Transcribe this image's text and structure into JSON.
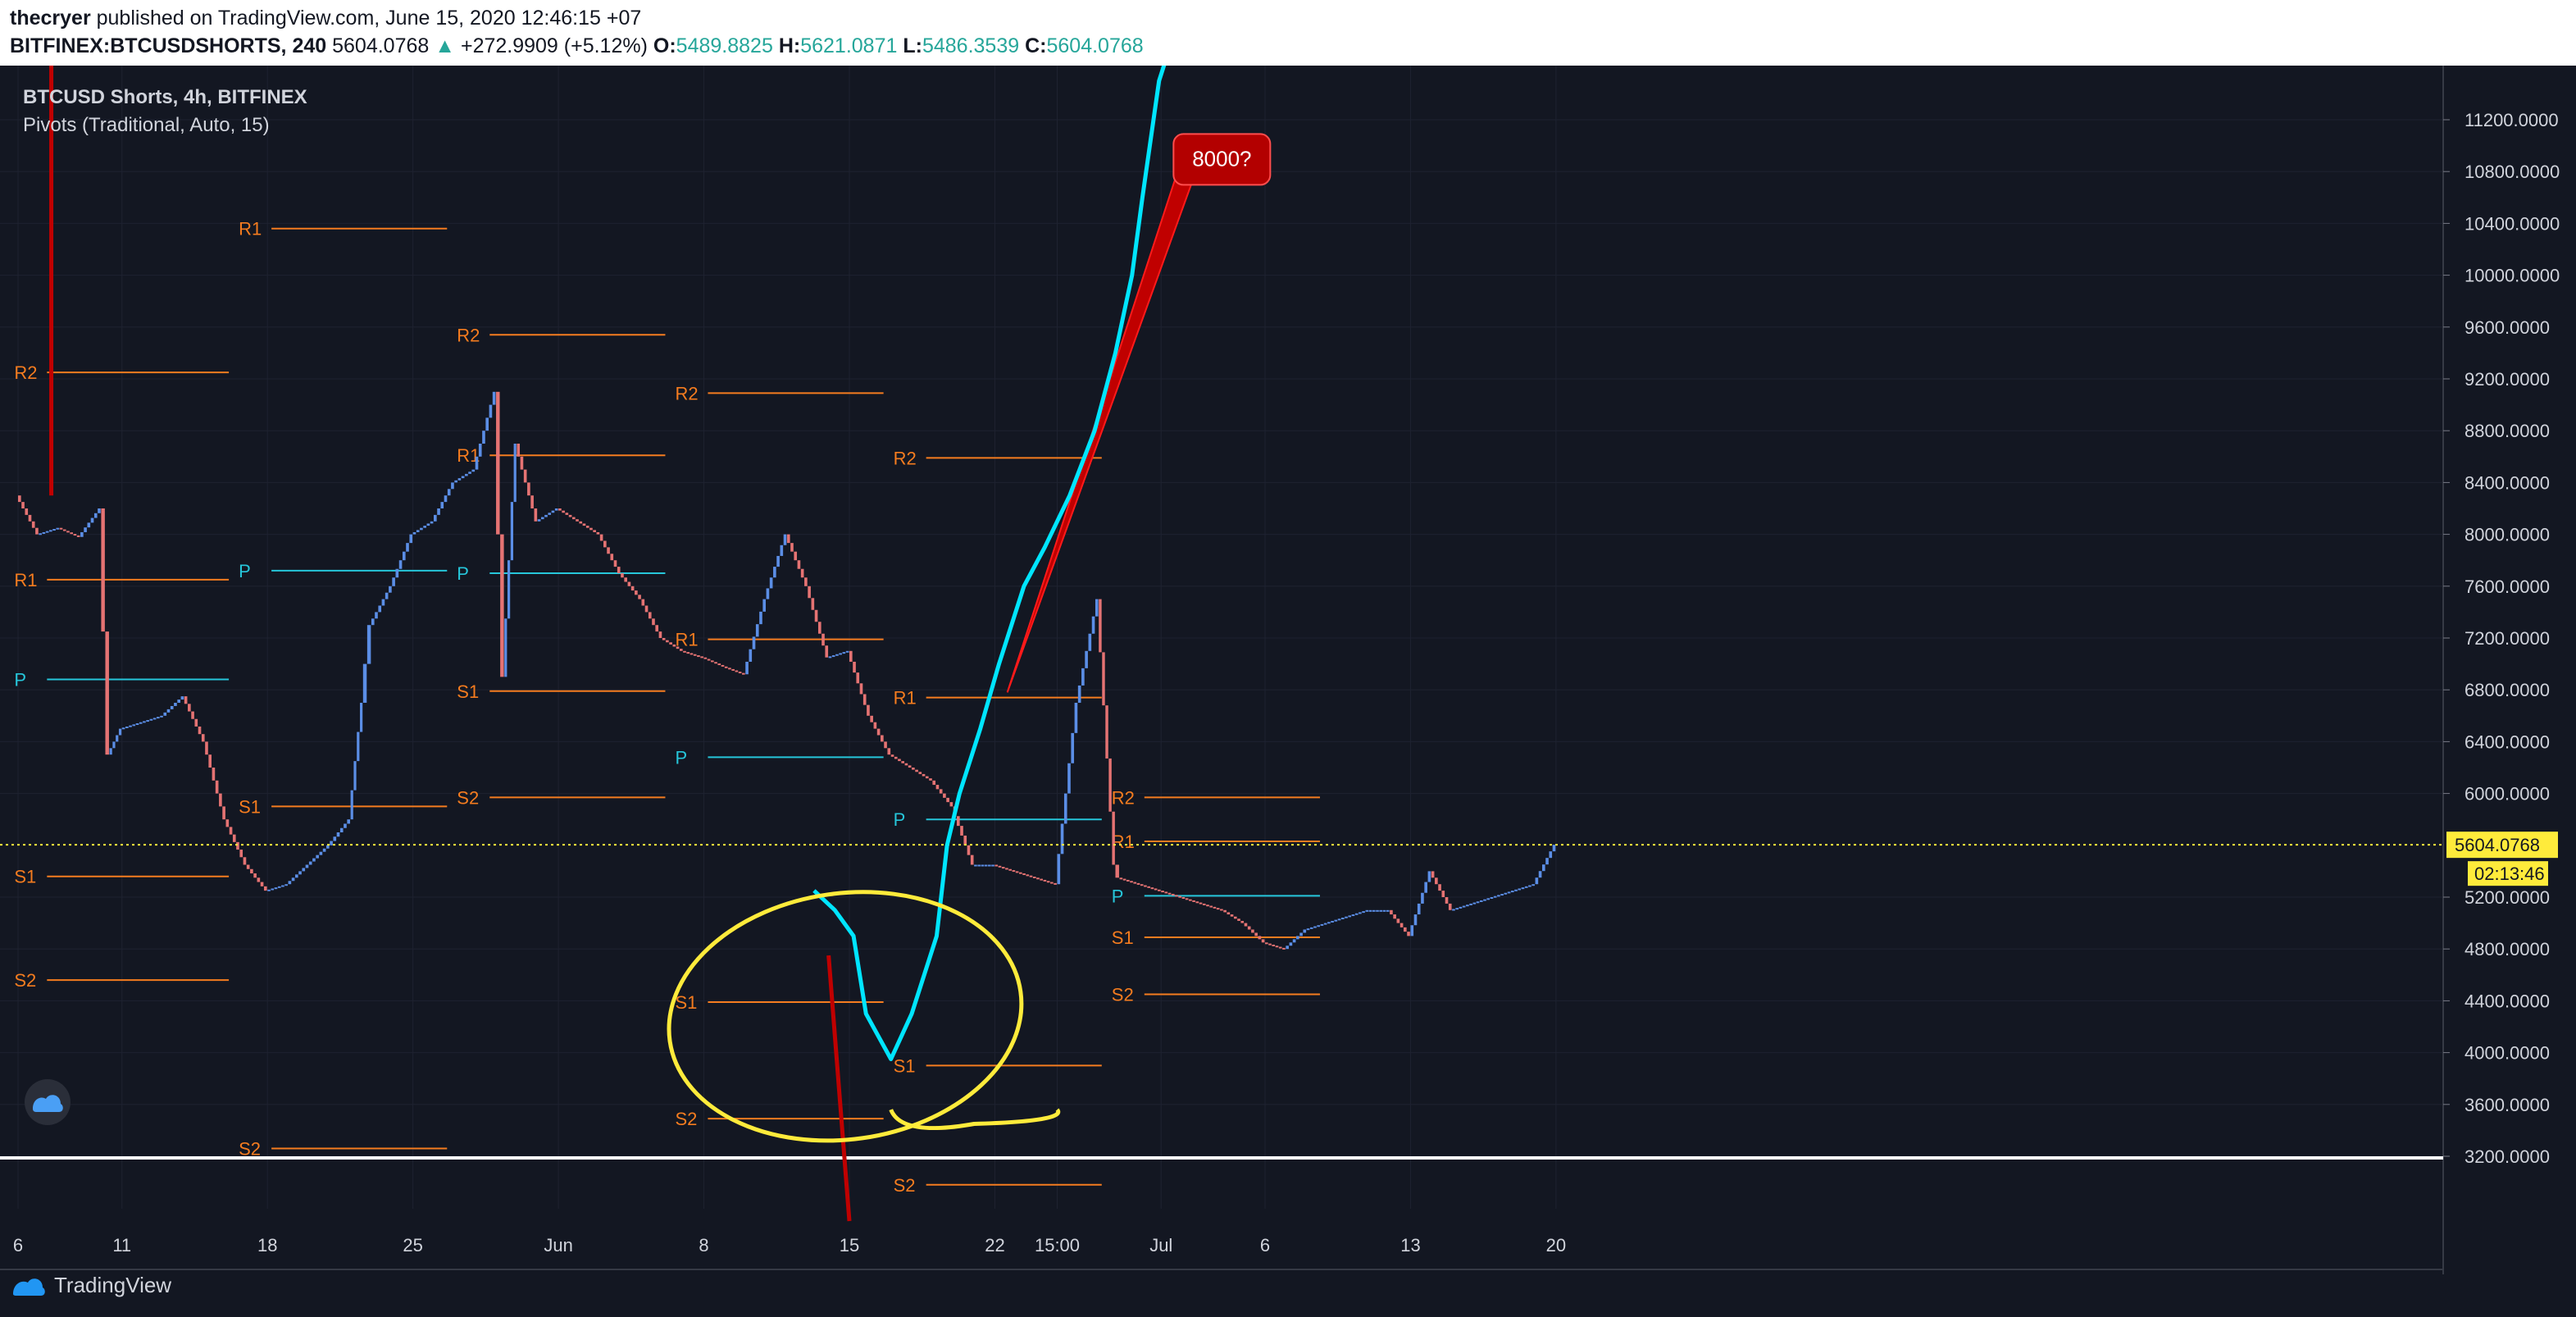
{
  "header": {
    "author": "thecryer",
    "published": "published on TradingView.com, June 15, 2020 12:46:15 +07",
    "symbol": "BITFINEX:BTCUSDSHORTS, 240",
    "last": "5604.0768",
    "change": "+272.9909 (+5.12%)",
    "o_label": "O:",
    "o": "5489.8825",
    "h_label": "H:",
    "h": "5621.0871",
    "l_label": "L:",
    "l": "5486.3539",
    "c_label": "C:",
    "c": "5604.0768"
  },
  "legend": {
    "title": "BTCUSD Shorts, 4h, BITFINEX",
    "indicator": "Pivots (Traditional, Auto, 15)"
  },
  "footer": {
    "brand": "TradingView"
  },
  "colors": {
    "background": "#131722",
    "grid": "#1e2230",
    "up": "#5b8ee6",
    "down": "#e57373",
    "pivot_orange": "#f57c1f",
    "pivot_cyan": "#26c6da",
    "price_line": "#ffeb3b",
    "annotation_red": "#c00000",
    "annotation_cyan": "#00e5ff",
    "annotation_yellow": "#ffeb3b"
  },
  "chart_data": {
    "type": "candlestick",
    "y_axis_labels": [
      "11200.0000",
      "10800.0000",
      "10400.0000",
      "10000.0000",
      "9600.0000",
      "9200.0000",
      "8800.0000",
      "8400.0000",
      "8000.0000",
      "7600.0000",
      "7200.0000",
      "6800.0000",
      "6400.0000",
      "6000.0000",
      "5200.0000",
      "4800.0000",
      "4400.0000",
      "4000.0000",
      "3600.0000",
      "3200.0000"
    ],
    "y_axis_values": [
      11200,
      10800,
      10400,
      10000,
      9600,
      9200,
      8800,
      8400,
      8000,
      7600,
      7200,
      6800,
      6400,
      6000,
      5200,
      4800,
      4400,
      4000,
      3600,
      3200
    ],
    "x_axis_labels": [
      "6",
      "11",
      "18",
      "25",
      "Jun",
      "8",
      "15",
      "22",
      "15:00",
      "Jul",
      "6",
      "13",
      "20"
    ],
    "x_axis_day_index": [
      0,
      5,
      12,
      19,
      26,
      33,
      40,
      47,
      50,
      55,
      60,
      67,
      74
    ],
    "ylim": [
      2760,
      11870
    ],
    "last_price": {
      "value": 5604.0768,
      "label": "5604.0768",
      "countdown": "02:13:46"
    },
    "close_path": [
      [
        0,
        8300
      ],
      [
        1,
        8000
      ],
      [
        2,
        8050
      ],
      [
        3,
        7980
      ],
      [
        4,
        8200
      ],
      [
        4.4,
        6300
      ],
      [
        5,
        6500
      ],
      [
        6,
        6550
      ],
      [
        7,
        6600
      ],
      [
        8,
        6750
      ],
      [
        9,
        6400
      ],
      [
        10,
        5800
      ],
      [
        11,
        5450
      ],
      [
        12,
        5250
      ],
      [
        13,
        5300
      ],
      [
        14,
        5450
      ],
      [
        15,
        5600
      ],
      [
        16,
        5800
      ],
      [
        16.6,
        6700
      ],
      [
        17,
        7300
      ],
      [
        18,
        7600
      ],
      [
        19,
        8000
      ],
      [
        20,
        8100
      ],
      [
        21,
        8400
      ],
      [
        22,
        8500
      ],
      [
        23,
        9100
      ],
      [
        23.4,
        6900
      ],
      [
        24,
        8700
      ],
      [
        25,
        8100
      ],
      [
        26,
        8200
      ],
      [
        27,
        8100
      ],
      [
        28,
        8000
      ],
      [
        29,
        7700
      ],
      [
        30,
        7500
      ],
      [
        31,
        7200
      ],
      [
        32,
        7100
      ],
      [
        33,
        7050
      ],
      [
        34,
        6980
      ],
      [
        35,
        6920
      ],
      [
        36,
        7500
      ],
      [
        37,
        8000
      ],
      [
        38,
        7600
      ],
      [
        39,
        7050
      ],
      [
        40,
        7100
      ],
      [
        41,
        6600
      ],
      [
        42,
        6300
      ],
      [
        43,
        6200
      ],
      [
        44,
        6100
      ],
      [
        45,
        5900
      ],
      [
        46,
        5450
      ],
      [
        47,
        5450
      ],
      [
        48,
        5400
      ],
      [
        49,
        5350
      ],
      [
        50,
        5300
      ],
      [
        51,
        6700
      ],
      [
        52,
        7500
      ],
      [
        52.8,
        5450
      ],
      [
        53,
        5350
      ],
      [
        54,
        5300
      ],
      [
        55,
        5250
      ],
      [
        56,
        5200
      ],
      [
        57,
        5150
      ],
      [
        58,
        5100
      ],
      [
        59,
        5000
      ],
      [
        60,
        4850
      ],
      [
        61,
        4800
      ],
      [
        62,
        4950
      ],
      [
        63,
        5000
      ],
      [
        64,
        5050
      ],
      [
        65,
        5100
      ],
      [
        66,
        5100
      ],
      [
        67,
        4900
      ],
      [
        68,
        5400
      ],
      [
        69,
        5100
      ],
      [
        70,
        5150
      ],
      [
        71,
        5200
      ],
      [
        72,
        5250
      ],
      [
        73,
        5300
      ],
      [
        74,
        5604
      ]
    ],
    "pivots": [
      {
        "period_start": -0.5,
        "period_end": 10.3,
        "levels": [
          {
            "name": "R2",
            "value": 9250
          },
          {
            "name": "R1",
            "value": 7650
          },
          {
            "name": "P",
            "value": 6880
          },
          {
            "name": "S1",
            "value": 5360
          },
          {
            "name": "S2",
            "value": 4560
          }
        ]
      },
      {
        "period_start": 10.3,
        "period_end": 20.8,
        "levels": [
          {
            "name": "R1",
            "value": 10360
          },
          {
            "name": "P",
            "value": 7720
          },
          {
            "name": "S1",
            "value": 5900
          },
          {
            "name": "S2",
            "value": 3260
          }
        ]
      },
      {
        "period_start": 20.8,
        "period_end": 31.3,
        "levels": [
          {
            "name": "R2",
            "value": 9540
          },
          {
            "name": "R1",
            "value": 8610
          },
          {
            "name": "P",
            "value": 7700
          },
          {
            "name": "S1",
            "value": 6790
          },
          {
            "name": "S2",
            "value": 5970
          }
        ]
      },
      {
        "period_start": 31.3,
        "period_end": 41.8,
        "levels": [
          {
            "name": "R2",
            "value": 9090
          },
          {
            "name": "R1",
            "value": 7190
          },
          {
            "name": "P",
            "value": 6280
          },
          {
            "name": "S1",
            "value": 4390
          },
          {
            "name": "S2",
            "value": 3490
          }
        ]
      },
      {
        "period_start": 41.8,
        "period_end": 52.3,
        "levels": [
          {
            "name": "R2",
            "value": 8590
          },
          {
            "name": "R1",
            "value": 6740
          },
          {
            "name": "P",
            "value": 5800
          },
          {
            "name": "S1",
            "value": 3900
          },
          {
            "name": "S2",
            "value": 2980
          }
        ]
      },
      {
        "period_start": 52.3,
        "period_end": 62.8,
        "levels": [
          {
            "name": "R2",
            "value": 5970
          },
          {
            "name": "R1",
            "value": 5630
          },
          {
            "name": "P",
            "value": 5210
          },
          {
            "name": "S1",
            "value": 4890
          },
          {
            "name": "S2",
            "value": 4450
          }
        ]
      }
    ],
    "annotations": {
      "callout_text": "8000?"
    }
  }
}
